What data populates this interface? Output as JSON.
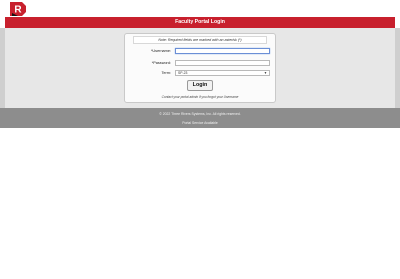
{
  "header": {
    "logo_text": "R",
    "brand_color": "#c8202d"
  },
  "page": {
    "title": "Faculty Portal Login"
  },
  "form": {
    "note": "Note: Required fields are marked with an asterisk (*)",
    "username_label": "*Username:",
    "username_value": "",
    "password_label": "*Password:",
    "password_value": "",
    "term_label": "Term:",
    "term_value": "SP-23",
    "login_label": "Login",
    "contact_text": "Contact your portal admin if you forgot your Username"
  },
  "footer": {
    "copyright": "© 2022 Three Rivers Systems, Inc. All rights reserved.",
    "service_link": "Portal Service Available"
  },
  "icons": {
    "logo": "three-rivers-logo",
    "dropdown": "chevron-down-icon"
  }
}
